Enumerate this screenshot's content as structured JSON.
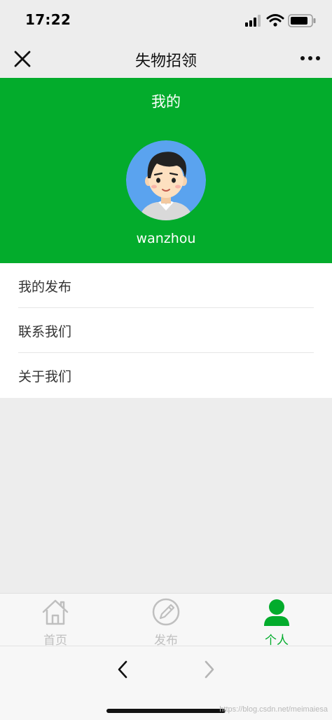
{
  "status_bar": {
    "time": "17:22"
  },
  "nav": {
    "title": "失物招领",
    "close_icon": "close-icon",
    "more_icon": "more-icon"
  },
  "profile": {
    "page_title": "我的",
    "username": "wanzhou",
    "avatar_icon": "avatar-illustration"
  },
  "menu": {
    "items": [
      {
        "label": "我的发布"
      },
      {
        "label": "联系我们"
      },
      {
        "label": "关于我们"
      }
    ]
  },
  "tabbar": {
    "tabs": [
      {
        "label": "首页",
        "icon": "home-icon",
        "active": false
      },
      {
        "label": "发布",
        "icon": "edit-icon",
        "active": false
      },
      {
        "label": "个人",
        "icon": "user-icon",
        "active": true
      }
    ]
  },
  "browser": {
    "back_icon": "chevron-left-icon",
    "forward_icon": "chevron-right-icon"
  },
  "watermark": "https://blog.csdn.net/meimaiesa",
  "colors": {
    "brand_green": "#03ac2c",
    "active_tab": "#03ac2c",
    "inactive_tab": "#bfbfbf"
  }
}
